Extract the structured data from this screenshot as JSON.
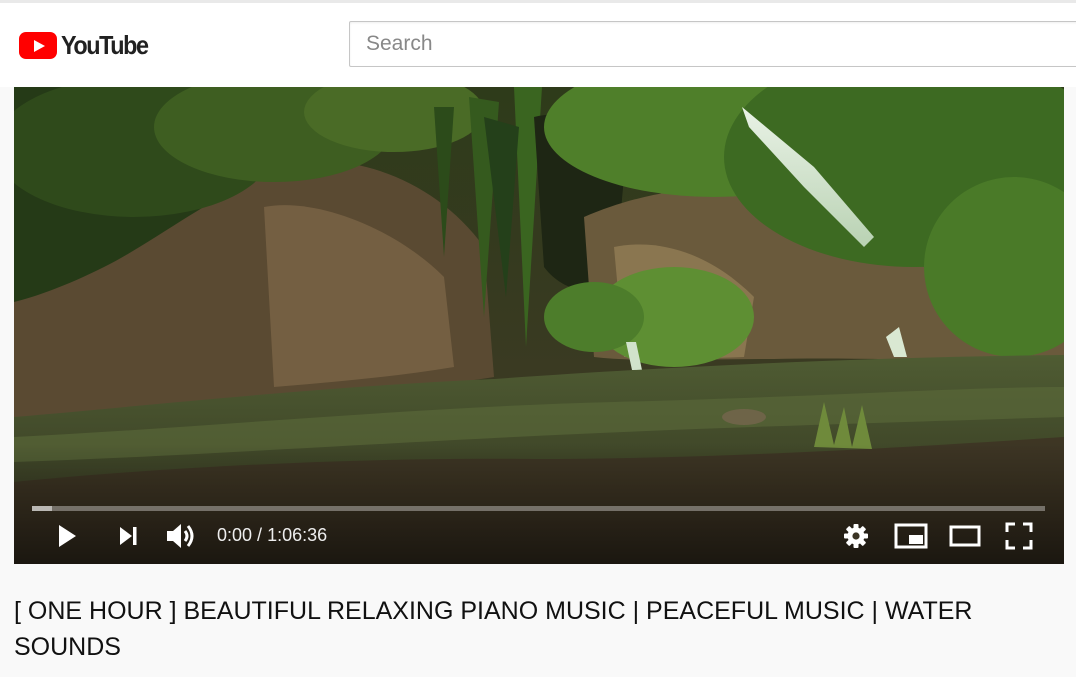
{
  "masthead": {
    "logo_text": "YouTube",
    "search_placeholder": "Search"
  },
  "player": {
    "time_current": "0:00",
    "time_separator": " / ",
    "time_duration": "1:06:36",
    "progress_played_fraction": 0,
    "progress_buffered_fraction": 0.02,
    "controls": [
      "play-icon",
      "next-icon",
      "volume-icon",
      "settings-icon",
      "miniplayer-icon",
      "theater-mode-icon",
      "fullscreen-icon"
    ],
    "colors": {
      "progress_played": "#ff0000",
      "controls": "#ffffff"
    }
  },
  "video": {
    "title": "[ ONE HOUR ] BEAUTIFUL RELAXING PIANO MUSIC | PEACEFUL MUSIC | WATER SOUNDS"
  },
  "colors": {
    "brand_red": "#ff0000",
    "page_background": "#f9f9f9"
  }
}
